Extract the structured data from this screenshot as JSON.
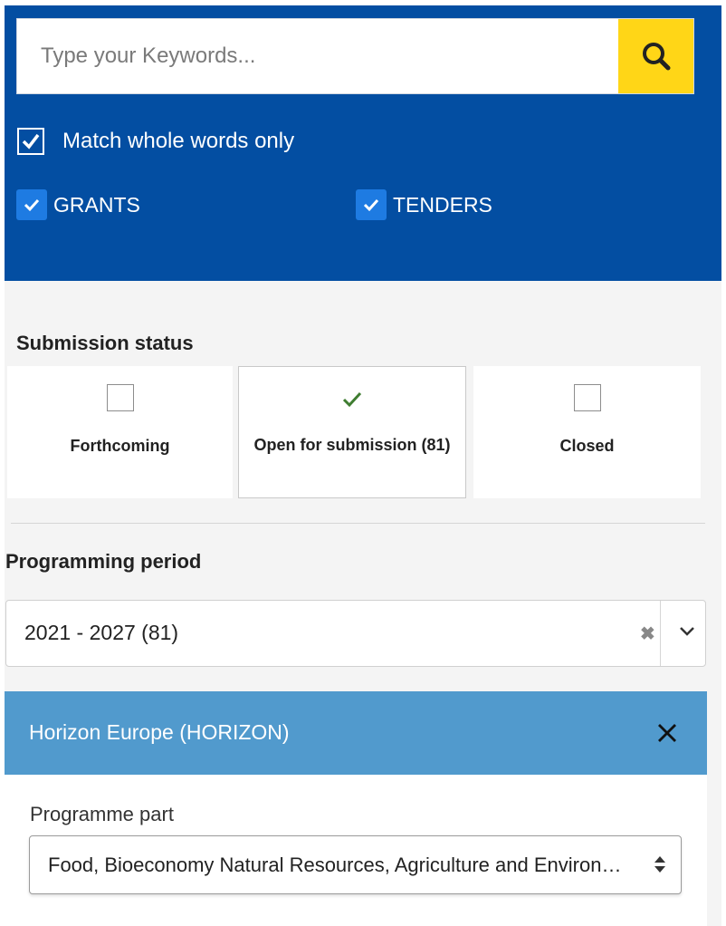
{
  "search": {
    "placeholder": "Type your Keywords...",
    "button_icon": "search-icon"
  },
  "filters": {
    "match_whole_words": {
      "label": "Match whole words only",
      "checked": true
    },
    "types": [
      {
        "label": "GRANTS",
        "checked": true
      },
      {
        "label": "TENDERS",
        "checked": true
      }
    ]
  },
  "submission_status": {
    "title": "Submission status",
    "options": [
      {
        "label": "Forthcoming",
        "checked": false
      },
      {
        "label": "Open for submission (81)",
        "checked": true
      },
      {
        "label": "Closed",
        "checked": false
      }
    ]
  },
  "programming_period": {
    "title": "Programming period",
    "selected": "2021 - 2027 (81)"
  },
  "programme": {
    "name": "Horizon Europe (HORIZON)",
    "part_label": "Programme part",
    "part_selected": "Food, Bioeconomy Natural Resources, Agriculture and Environment"
  },
  "colors": {
    "header_blue": "#034ea2",
    "search_button_yellow": "#ffd617",
    "checkbox_blue": "#1e7be2",
    "programme_header_blue": "#519acd",
    "check_green": "#3f7d31"
  }
}
